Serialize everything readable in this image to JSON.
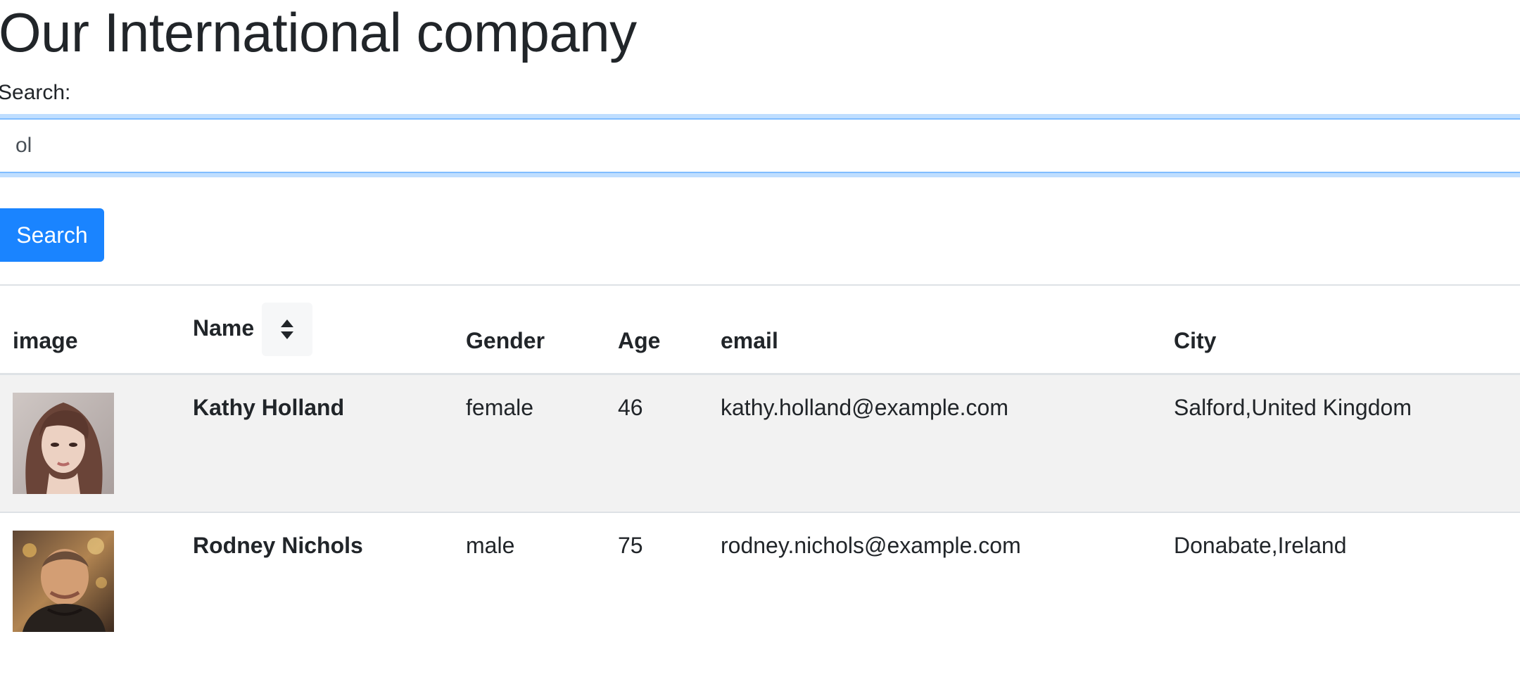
{
  "header": {
    "title": "Our International company"
  },
  "search": {
    "label": "Search:",
    "value": "ol",
    "button_label": "Search"
  },
  "table": {
    "columns": [
      "image",
      "Name",
      "Gender",
      "Age",
      "email",
      "City"
    ],
    "sort_icon": "sort-icon",
    "rows": [
      {
        "avatar_icon": "avatar-woman",
        "name": "Kathy Holland",
        "gender": "female",
        "age": "46",
        "email": "kathy.holland@example.com",
        "city": "Salford,United Kingdom"
      },
      {
        "avatar_icon": "avatar-man",
        "name": "Rodney Nichols",
        "gender": "male",
        "age": "75",
        "email": "rodney.nichols@example.com",
        "city": "Donabate,Ireland"
      }
    ]
  },
  "colors": {
    "primary_button": "#1a84ff",
    "focus_border": "#80bdff",
    "striped_row": "#f2f2f2",
    "text": "#212529"
  }
}
